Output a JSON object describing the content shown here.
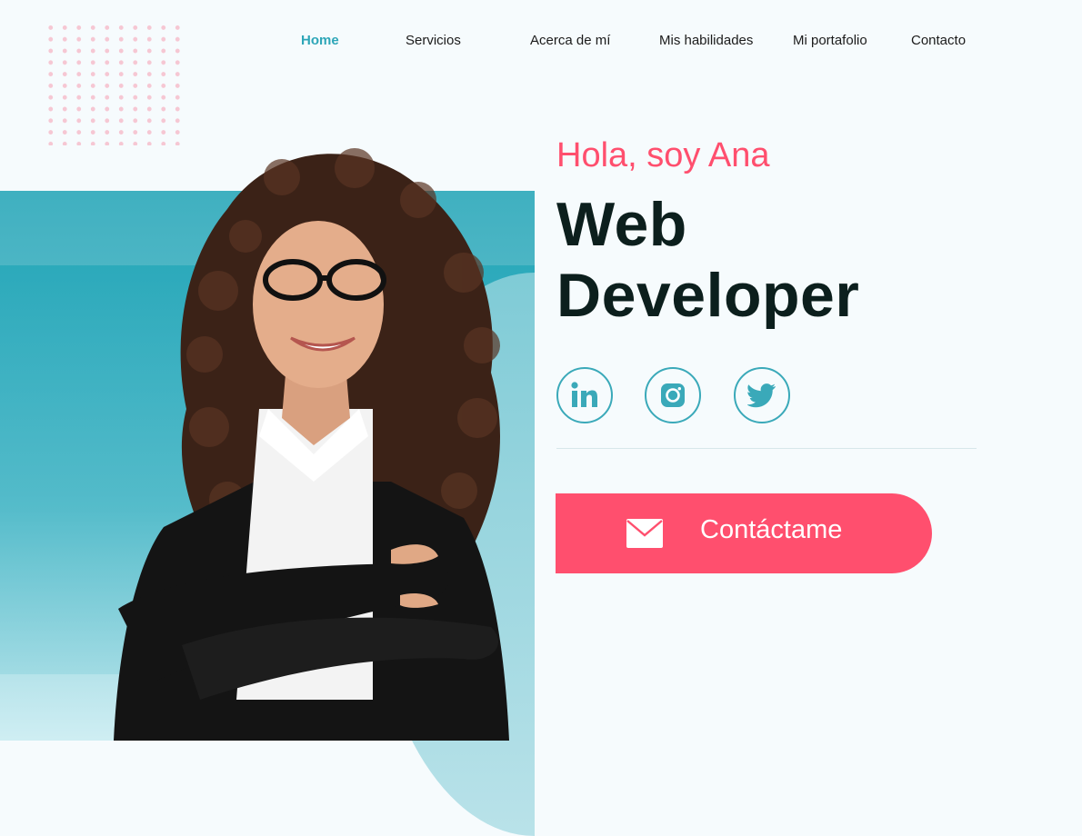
{
  "nav": {
    "items": [
      {
        "label": "Home"
      },
      {
        "label": "Servicios"
      },
      {
        "label": "Acerca de mí"
      },
      {
        "label": "Mis habilidades"
      },
      {
        "label": "Mi portafolio"
      },
      {
        "label": "Contacto"
      }
    ],
    "active": "Home"
  },
  "hero": {
    "greeting": "Hola, soy Ana",
    "title_line1": "Web",
    "title_line2": "Developer"
  },
  "social": {
    "icons": [
      "linkedin-icon",
      "instagram-icon",
      "twitter-icon"
    ]
  },
  "cta": {
    "label": "Contáctame",
    "icon": "mail-icon"
  },
  "colors": {
    "accent": "#ff4f6e",
    "teal": "#3aa9b9",
    "heading": "#0c1f1d",
    "background": "#f6fbfd"
  }
}
